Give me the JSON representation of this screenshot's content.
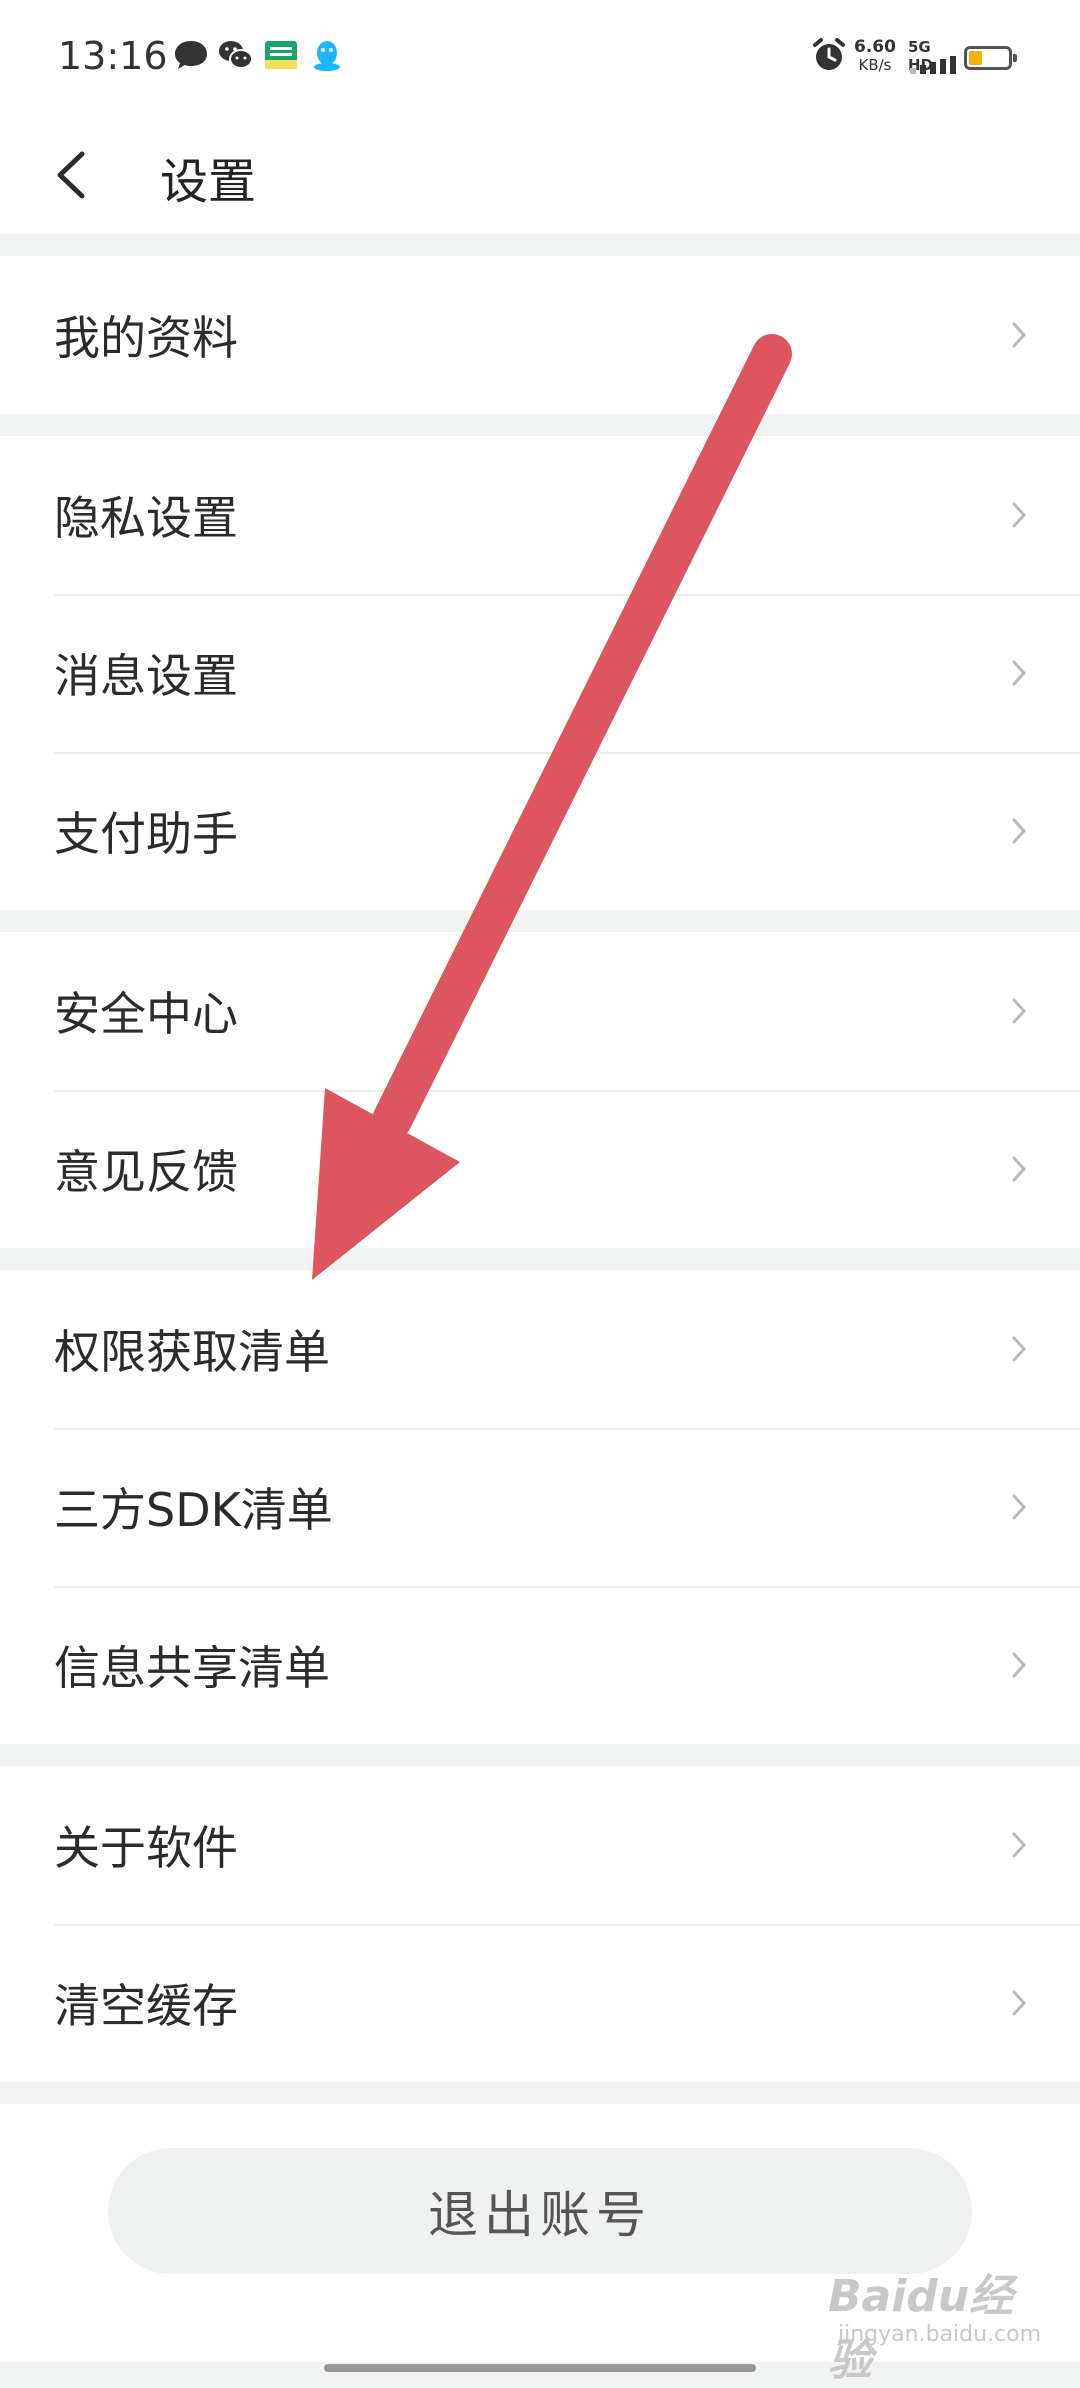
{
  "status_bar": {
    "time": "13:16",
    "net_speed_value": "6.60",
    "net_speed_unit": "KB/s",
    "network_label": "5G HD",
    "battery_level_percent": 35,
    "icons": [
      "message-bubble-icon",
      "wechat-icon",
      "app-badge-icon",
      "qq-penguin-icon",
      "alarm-icon",
      "signal-icon",
      "battery-icon"
    ]
  },
  "header": {
    "title": "设置",
    "back_icon": "chevron-left-icon"
  },
  "groups": [
    {
      "items": [
        {
          "label": "我的资料"
        }
      ]
    },
    {
      "items": [
        {
          "label": "隐私设置"
        },
        {
          "label": "消息设置"
        },
        {
          "label": "支付助手"
        }
      ]
    },
    {
      "items": [
        {
          "label": "安全中心"
        },
        {
          "label": "意见反馈"
        }
      ]
    },
    {
      "items": [
        {
          "label": "权限获取清单"
        },
        {
          "label": "三方SDK清单"
        },
        {
          "label": "信息共享清单"
        }
      ]
    },
    {
      "items": [
        {
          "label": "关于软件"
        },
        {
          "label": "清空缓存"
        }
      ]
    }
  ],
  "logout": {
    "label": "退出账号"
  },
  "watermark": {
    "main": "Baidu经验",
    "sub": "jingyan.baidu.com"
  },
  "colors": {
    "background": "#f1f3f3",
    "surface": "#ffffff",
    "text": "#2b2b2b",
    "chevron": "#b8b8b8",
    "annotation_arrow": "#dc555f",
    "battery_fill": "#f2b400"
  }
}
